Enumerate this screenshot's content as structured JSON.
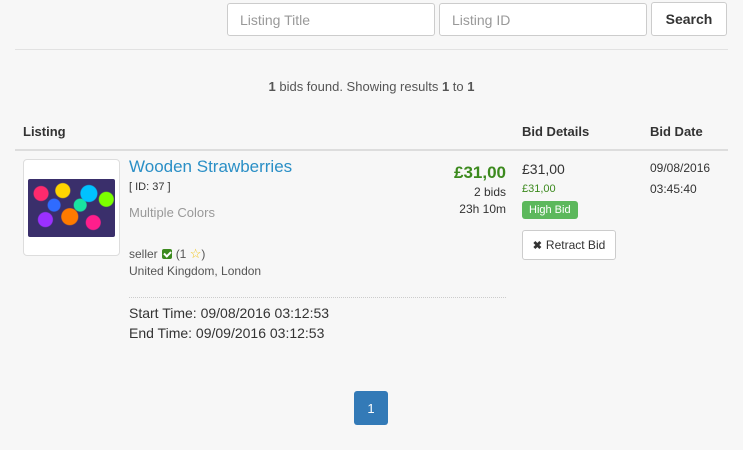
{
  "search": {
    "title_placeholder": "Listing Title",
    "id_placeholder": "Listing ID",
    "button_label": "Search"
  },
  "summary": {
    "count": "1",
    "text_mid": " bids found. Showing results ",
    "from": "1",
    "to_word": " to ",
    "to": "1"
  },
  "table": {
    "headers": {
      "listing": "Listing",
      "bid_details": "Bid Details",
      "bid_date": "Bid Date"
    }
  },
  "listing": {
    "title": "Wooden Strawberries",
    "id_text": "[ ID: 37 ]",
    "subtitle": "Multiple Colors",
    "price": "£31,00",
    "bids": "2 bids",
    "time_left": "23h 10m",
    "seller_name": "seller",
    "feedback_open": "(1",
    "feedback_close": ")",
    "location": "United Kingdom, London",
    "start_time": "Start Time: 09/08/2016 03:12:53",
    "end_time": "End Time: 09/09/2016 03:12:53",
    "image_icon": "colorful-beads-photo"
  },
  "bid": {
    "amount": "£31,00",
    "sub_amount": "£31,00",
    "badge": "High Bid",
    "retract_label": "Retract Bid",
    "date": "09/08/2016",
    "time": "03:45:40"
  },
  "pagination": {
    "current": "1"
  },
  "colors": {
    "link": "#2a8fc6",
    "price": "#3c8a1e",
    "badge": "#5cb85c",
    "page_active": "#337ab7"
  }
}
